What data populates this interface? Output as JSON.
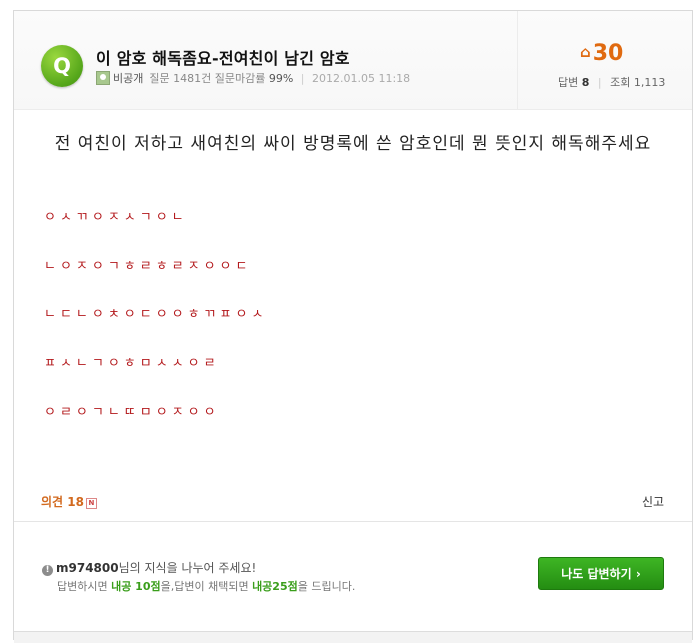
{
  "header": {
    "badge": "Q",
    "title": "이 암호 해독좀요-전여친이 남긴 암호",
    "user": "비공개",
    "question_stats": "질문 1481건 질문마감률",
    "close_rate": "99%",
    "date": "2012.01.05 11:18",
    "points": "30",
    "answers_label": "답변",
    "answers_count": "8",
    "views_label": "조회",
    "views_count": "1,113"
  },
  "body": {
    "question": "전 여친이 저하고 새여친의 싸이 방명록에 쓴 암호인데 뭔 뜻인지 해독해주세요",
    "cipher_lines": [
      "ㅇㅅㄲㅇㅈㅅㄱㅇㄴ",
      "ㄴㅇㅈㅇㄱㅎㄹㅎㄹㅈㅇㅇㄷ",
      "ㄴㄷㄴㅇㅊㅇㄷㅇㅇㅎㄲㅍㅇㅅ",
      "ㅍㅅㄴㄱㅇㅎㅁㅅㅅㅇㄹ",
      "ㅇㄹㅇㄱㄴㄸㅁㅇㅈㅇㅇ"
    ]
  },
  "actions": {
    "opinions_label": "의견",
    "opinions_count": "18",
    "new_badge": "N",
    "report": "신고"
  },
  "footer": {
    "info_icon": "!",
    "username": "m974800",
    "share_text": "님의 지식을 나누어 주세요!",
    "l2_a": "답변하시면 ",
    "l2_b": "내공 10점",
    "l2_c": "을,답변이 채택되면 ",
    "l2_d": "내공25점",
    "l2_e": "을 드립니다.",
    "answer_button": "나도 답변하기 ›"
  }
}
